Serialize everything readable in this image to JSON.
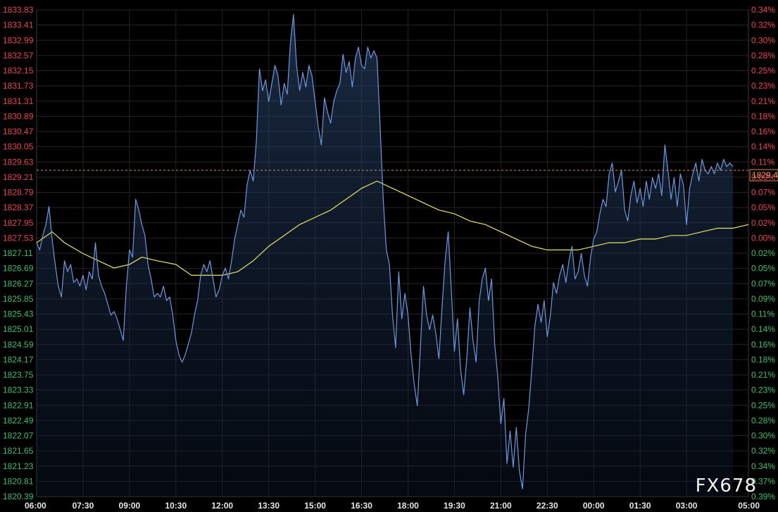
{
  "chart_data": {
    "type": "line",
    "title": "",
    "xlabel": "",
    "ylabel": "",
    "x_ticks": [
      "06:00",
      "07:30",
      "09:00",
      "10:30",
      "12:00",
      "13:30",
      "15:00",
      "16:30",
      "18:00",
      "19:30",
      "21:00",
      "22:30",
      "00:00",
      "01:30",
      "03:00",
      "05:00"
    ],
    "xlim_hours": [
      0,
      23
    ],
    "ylim": [
      1820.39,
      1833.83
    ],
    "y_ticks": [
      1833.83,
      1833.41,
      1832.99,
      1832.57,
      1832.15,
      1831.73,
      1831.31,
      1830.89,
      1830.47,
      1830.05,
      1829.63,
      1829.21,
      1828.79,
      1828.37,
      1827.95,
      1827.53,
      1827.11,
      1826.69,
      1826.27,
      1825.85,
      1825.43,
      1825.01,
      1824.59,
      1824.17,
      1823.75,
      1823.33,
      1822.91,
      1822.49,
      1822.07,
      1821.65,
      1821.23,
      1820.81,
      1820.39
    ],
    "y_ticks_pct": [
      "0.34%",
      "0.32%",
      "0.30%",
      "0.28%",
      "0.25%",
      "0.23%",
      "0.21%",
      "0.18%",
      "0.16%",
      "0.14%",
      "0.11%",
      "0.09%",
      "0.07%",
      "0.05%",
      "0.02%",
      "0.00%",
      "0.02%",
      "0.05%",
      "0.07%",
      "0.09%",
      "0.11%",
      "0.14%",
      "0.16%",
      "0.18%",
      "0.21%",
      "0.23%",
      "0.25%",
      "0.28%",
      "0.30%",
      "0.32%",
      "0.34%",
      "0.37%",
      "0.39%"
    ],
    "reference_price": 1827.53,
    "current_price": 1829.4,
    "current_price_label": "1829.4",
    "grid": true,
    "series": [
      {
        "color": "#6f98e0",
        "style": "price",
        "points": [
          [
            0.0,
            1827.4
          ],
          [
            0.1,
            1827.2
          ],
          [
            0.2,
            1827.6
          ],
          [
            0.3,
            1827.9
          ],
          [
            0.4,
            1828.4
          ],
          [
            0.5,
            1827.5
          ],
          [
            0.6,
            1826.8
          ],
          [
            0.7,
            1826.2
          ],
          [
            0.8,
            1825.9
          ],
          [
            0.9,
            1826.9
          ],
          [
            1.0,
            1826.6
          ],
          [
            1.1,
            1826.8
          ],
          [
            1.2,
            1826.3
          ],
          [
            1.3,
            1826.4
          ],
          [
            1.4,
            1826.2
          ],
          [
            1.5,
            1826.5
          ],
          [
            1.6,
            1826.1
          ],
          [
            1.7,
            1826.6
          ],
          [
            1.8,
            1826.4
          ],
          [
            1.9,
            1827.4
          ],
          [
            2.0,
            1826.5
          ],
          [
            2.1,
            1826.2
          ],
          [
            2.2,
            1826.0
          ],
          [
            2.3,
            1825.7
          ],
          [
            2.4,
            1825.4
          ],
          [
            2.5,
            1825.5
          ],
          [
            2.6,
            1825.3
          ],
          [
            2.7,
            1825.0
          ],
          [
            2.8,
            1824.7
          ],
          [
            2.9,
            1826.2
          ],
          [
            3.0,
            1827.2
          ],
          [
            3.1,
            1827.0
          ],
          [
            3.2,
            1828.6
          ],
          [
            3.3,
            1828.3
          ],
          [
            3.4,
            1827.9
          ],
          [
            3.5,
            1827.6
          ],
          [
            3.6,
            1826.8
          ],
          [
            3.7,
            1826.4
          ],
          [
            3.8,
            1825.9
          ],
          [
            3.9,
            1826.0
          ],
          [
            4.0,
            1825.9
          ],
          [
            4.1,
            1826.2
          ],
          [
            4.2,
            1825.8
          ],
          [
            4.3,
            1825.9
          ],
          [
            4.4,
            1825.4
          ],
          [
            4.5,
            1824.7
          ],
          [
            4.6,
            1824.3
          ],
          [
            4.7,
            1824.1
          ],
          [
            4.8,
            1824.3
          ],
          [
            4.9,
            1824.6
          ],
          [
            5.0,
            1824.9
          ],
          [
            5.1,
            1825.4
          ],
          [
            5.2,
            1825.8
          ],
          [
            5.3,
            1826.5
          ],
          [
            5.4,
            1826.8
          ],
          [
            5.5,
            1826.6
          ],
          [
            5.6,
            1826.9
          ],
          [
            5.7,
            1826.4
          ],
          [
            5.8,
            1825.9
          ],
          [
            5.9,
            1826.1
          ],
          [
            6.0,
            1826.5
          ],
          [
            6.1,
            1826.7
          ],
          [
            6.2,
            1826.4
          ],
          [
            6.3,
            1826.9
          ],
          [
            6.4,
            1827.5
          ],
          [
            6.5,
            1827.9
          ],
          [
            6.6,
            1828.3
          ],
          [
            6.7,
            1828.1
          ],
          [
            6.8,
            1829.0
          ],
          [
            6.9,
            1829.4
          ],
          [
            7.0,
            1829.1
          ],
          [
            7.1,
            1830.2
          ],
          [
            7.2,
            1832.2
          ],
          [
            7.3,
            1831.6
          ],
          [
            7.4,
            1831.9
          ],
          [
            7.5,
            1831.3
          ],
          [
            7.6,
            1831.8
          ],
          [
            7.7,
            1832.3
          ],
          [
            7.8,
            1832.0
          ],
          [
            7.9,
            1831.2
          ],
          [
            8.0,
            1831.8
          ],
          [
            8.1,
            1831.5
          ],
          [
            8.2,
            1832.9
          ],
          [
            8.3,
            1833.7
          ],
          [
            8.4,
            1832.3
          ],
          [
            8.5,
            1831.6
          ],
          [
            8.6,
            1832.1
          ],
          [
            8.7,
            1831.7
          ],
          [
            8.8,
            1832.3
          ],
          [
            8.9,
            1832.0
          ],
          [
            9.0,
            1831.3
          ],
          [
            9.1,
            1830.6
          ],
          [
            9.2,
            1830.1
          ],
          [
            9.3,
            1831.4
          ],
          [
            9.4,
            1831.0
          ],
          [
            9.5,
            1830.7
          ],
          [
            9.6,
            1831.3
          ],
          [
            9.7,
            1831.6
          ],
          [
            9.8,
            1831.8
          ],
          [
            9.9,
            1832.6
          ],
          [
            10.0,
            1832.1
          ],
          [
            10.1,
            1832.4
          ],
          [
            10.2,
            1831.7
          ],
          [
            10.3,
            1832.5
          ],
          [
            10.4,
            1832.8
          ],
          [
            10.5,
            1832.3
          ],
          [
            10.6,
            1832.2
          ],
          [
            10.7,
            1832.8
          ],
          [
            10.8,
            1832.5
          ],
          [
            10.9,
            1832.7
          ],
          [
            11.0,
            1832.5
          ],
          [
            11.1,
            1830.6
          ],
          [
            11.2,
            1828.6
          ],
          [
            11.3,
            1827.2
          ],
          [
            11.4,
            1826.8
          ],
          [
            11.5,
            1825.4
          ],
          [
            11.6,
            1824.5
          ],
          [
            11.7,
            1826.6
          ],
          [
            11.8,
            1825.3
          ],
          [
            11.9,
            1826.0
          ],
          [
            12.0,
            1825.4
          ],
          [
            12.1,
            1824.3
          ],
          [
            12.2,
            1823.5
          ],
          [
            12.3,
            1822.9
          ],
          [
            12.4,
            1824.5
          ],
          [
            12.5,
            1826.2
          ],
          [
            12.6,
            1825.4
          ],
          [
            12.7,
            1825.0
          ],
          [
            12.8,
            1825.4
          ],
          [
            12.9,
            1824.9
          ],
          [
            13.0,
            1824.2
          ],
          [
            13.1,
            1825.6
          ],
          [
            13.2,
            1826.9
          ],
          [
            13.3,
            1827.7
          ],
          [
            13.4,
            1826.1
          ],
          [
            13.5,
            1824.4
          ],
          [
            13.6,
            1825.3
          ],
          [
            13.7,
            1823.9
          ],
          [
            13.8,
            1823.2
          ],
          [
            13.9,
            1824.2
          ],
          [
            14.0,
            1825.6
          ],
          [
            14.1,
            1824.7
          ],
          [
            14.2,
            1824.1
          ],
          [
            14.3,
            1825.8
          ],
          [
            14.4,
            1826.4
          ],
          [
            14.5,
            1826.7
          ],
          [
            14.6,
            1825.8
          ],
          [
            14.7,
            1826.4
          ],
          [
            14.8,
            1824.6
          ],
          [
            14.9,
            1823.7
          ],
          [
            15.0,
            1822.4
          ],
          [
            15.1,
            1823.1
          ],
          [
            15.2,
            1821.3
          ],
          [
            15.3,
            1822.2
          ],
          [
            15.4,
            1821.2
          ],
          [
            15.5,
            1822.3
          ],
          [
            15.6,
            1821.1
          ],
          [
            15.7,
            1820.6
          ],
          [
            15.8,
            1822.1
          ],
          [
            15.9,
            1822.8
          ],
          [
            16.0,
            1823.9
          ],
          [
            16.1,
            1825.1
          ],
          [
            16.2,
            1825.7
          ],
          [
            16.3,
            1825.2
          ],
          [
            16.4,
            1825.8
          ],
          [
            16.5,
            1824.8
          ],
          [
            16.6,
            1825.4
          ],
          [
            16.7,
            1826.3
          ],
          [
            16.8,
            1826.0
          ],
          [
            16.9,
            1826.5
          ],
          [
            17.0,
            1826.8
          ],
          [
            17.1,
            1826.3
          ],
          [
            17.2,
            1826.9
          ],
          [
            17.3,
            1827.3
          ],
          [
            17.4,
            1826.4
          ],
          [
            17.5,
            1826.6
          ],
          [
            17.6,
            1827.1
          ],
          [
            17.7,
            1826.5
          ],
          [
            17.8,
            1826.2
          ],
          [
            17.9,
            1827.0
          ],
          [
            18.0,
            1827.5
          ],
          [
            18.1,
            1827.7
          ],
          [
            18.2,
            1828.2
          ],
          [
            18.3,
            1828.6
          ],
          [
            18.4,
            1828.4
          ],
          [
            18.5,
            1829.3
          ],
          [
            18.6,
            1829.6
          ],
          [
            18.7,
            1828.8
          ],
          [
            18.8,
            1829.1
          ],
          [
            18.9,
            1829.4
          ],
          [
            19.0,
            1828.3
          ],
          [
            19.1,
            1828.0
          ],
          [
            19.2,
            1828.7
          ],
          [
            19.3,
            1829.1
          ],
          [
            19.4,
            1828.5
          ],
          [
            19.5,
            1828.9
          ],
          [
            19.6,
            1828.4
          ],
          [
            19.7,
            1829.1
          ],
          [
            19.8,
            1828.6
          ],
          [
            19.9,
            1829.2
          ],
          [
            20.0,
            1828.9
          ],
          [
            20.1,
            1829.3
          ],
          [
            20.2,
            1828.7
          ],
          [
            20.3,
            1830.1
          ],
          [
            20.4,
            1829.4
          ],
          [
            20.5,
            1828.6
          ],
          [
            20.6,
            1829.2
          ],
          [
            20.7,
            1828.4
          ],
          [
            20.8,
            1829.3
          ],
          [
            20.9,
            1829.0
          ],
          [
            21.0,
            1827.9
          ],
          [
            21.1,
            1828.9
          ],
          [
            21.2,
            1829.3
          ],
          [
            21.3,
            1829.6
          ],
          [
            21.4,
            1829.1
          ],
          [
            21.5,
            1829.7
          ],
          [
            21.6,
            1829.4
          ],
          [
            21.7,
            1829.3
          ],
          [
            21.8,
            1829.5
          ],
          [
            21.9,
            1829.3
          ],
          [
            22.0,
            1829.6
          ],
          [
            22.1,
            1829.4
          ],
          [
            22.2,
            1829.7
          ],
          [
            22.3,
            1829.5
          ],
          [
            22.4,
            1829.6
          ],
          [
            22.5,
            1829.5
          ]
        ]
      },
      {
        "color": "#e8e36a",
        "style": "average",
        "points": [
          [
            0.0,
            1827.4
          ],
          [
            0.5,
            1827.7
          ],
          [
            0.9,
            1827.4
          ],
          [
            1.5,
            1827.1
          ],
          [
            2.0,
            1826.9
          ],
          [
            2.5,
            1826.7
          ],
          [
            3.0,
            1826.8
          ],
          [
            3.4,
            1827.0
          ],
          [
            3.9,
            1826.9
          ],
          [
            4.5,
            1826.8
          ],
          [
            5.0,
            1826.5
          ],
          [
            5.5,
            1826.5
          ],
          [
            6.0,
            1826.5
          ],
          [
            6.5,
            1826.6
          ],
          [
            7.0,
            1826.9
          ],
          [
            7.5,
            1827.3
          ],
          [
            8.0,
            1827.6
          ],
          [
            8.5,
            1827.9
          ],
          [
            9.0,
            1828.1
          ],
          [
            9.5,
            1828.3
          ],
          [
            10.0,
            1828.6
          ],
          [
            10.5,
            1828.9
          ],
          [
            11.0,
            1829.1
          ],
          [
            11.5,
            1828.9
          ],
          [
            12.0,
            1828.7
          ],
          [
            12.5,
            1828.5
          ],
          [
            13.0,
            1828.3
          ],
          [
            13.5,
            1828.2
          ],
          [
            14.0,
            1828.0
          ],
          [
            14.5,
            1827.9
          ],
          [
            15.0,
            1827.7
          ],
          [
            15.5,
            1827.5
          ],
          [
            16.0,
            1827.3
          ],
          [
            16.5,
            1827.2
          ],
          [
            17.0,
            1827.2
          ],
          [
            17.5,
            1827.2
          ],
          [
            18.0,
            1827.3
          ],
          [
            18.5,
            1827.4
          ],
          [
            19.0,
            1827.4
          ],
          [
            19.5,
            1827.5
          ],
          [
            20.0,
            1827.5
          ],
          [
            20.5,
            1827.6
          ],
          [
            21.0,
            1827.6
          ],
          [
            21.5,
            1827.7
          ],
          [
            22.0,
            1827.8
          ],
          [
            22.5,
            1827.8
          ],
          [
            23.0,
            1827.9
          ]
        ]
      }
    ]
  },
  "watermark": "FX678"
}
